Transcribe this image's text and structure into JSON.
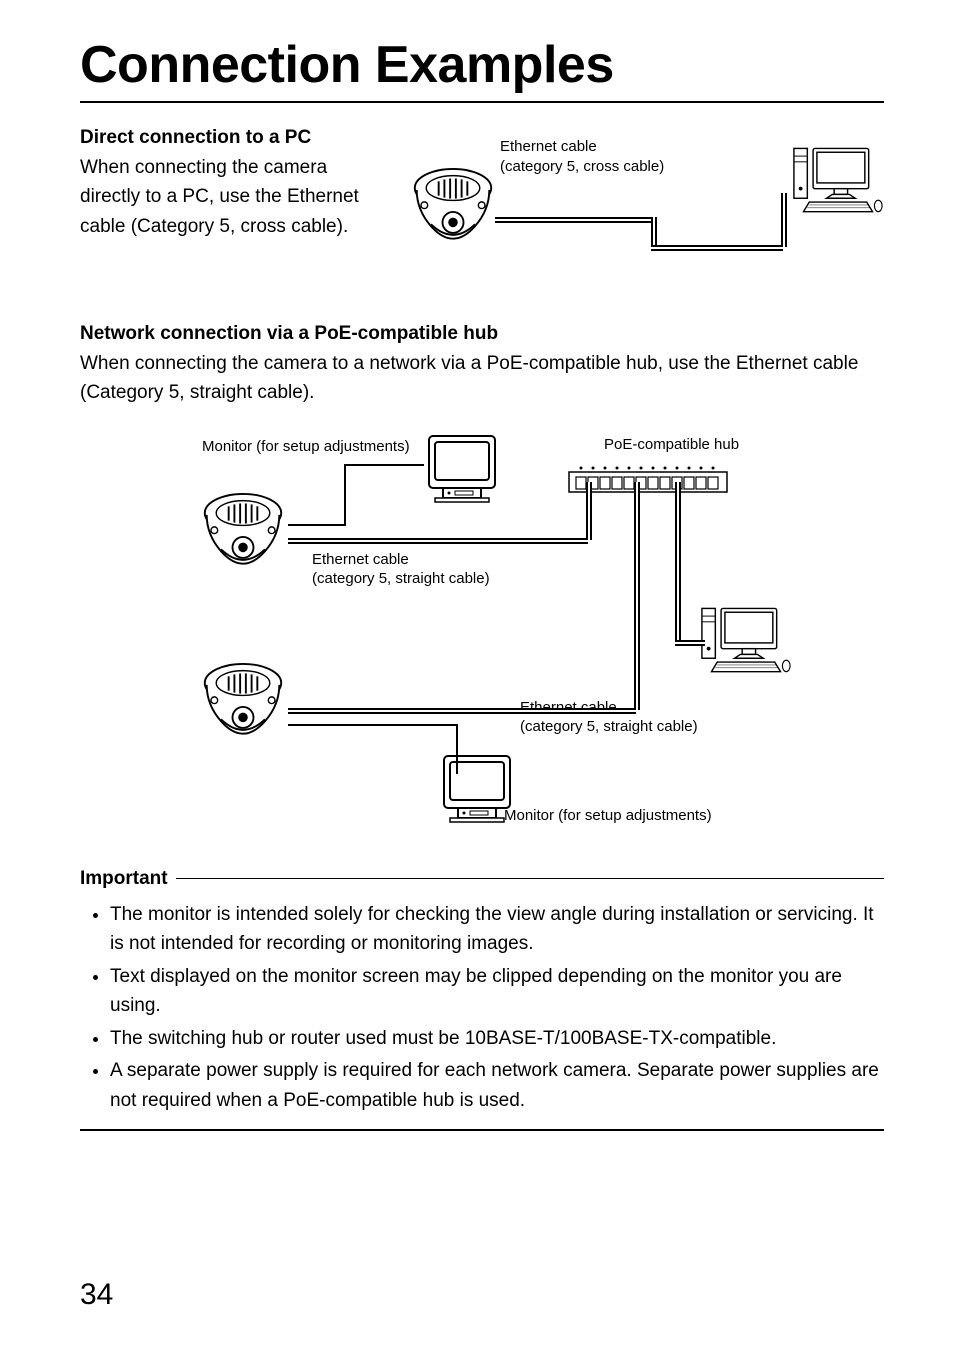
{
  "title": "Connection Examples",
  "section1": {
    "heading": "Direct connection to a PC",
    "text": "When connecting the camera directly to a PC, use the Ethernet cable (Category 5, cross cable).",
    "label_cable_line1": "Ethernet cable",
    "label_cable_line2": "(category 5, cross cable)"
  },
  "section2": {
    "heading": "Network connection via a PoE-compatible hub",
    "text": "When connecting the camera to a network via a PoE-compatible hub, use the Ethernet cable (Category 5, straight cable).",
    "label_monitor1": "Monitor (for setup adjustments)",
    "label_hub": "PoE-compatible hub",
    "label_eth1_line1": "Ethernet cable",
    "label_eth1_line2": "(category 5, straight cable)",
    "label_eth2_line1": "Ethernet cable",
    "label_eth2_line2": "(category 5, straight cable)",
    "label_monitor2": "Monitor (for setup adjustments)"
  },
  "important": {
    "heading": "Important",
    "items": [
      "The monitor is intended solely for checking the view angle during installation or servicing. It is not intended for recording or monitoring images.",
      "Text displayed on the monitor screen may be clipped depending on the monitor you are using.",
      "The switching hub or router used must be 10BASE-T/100BASE-TX-compatible.",
      "A separate power supply is required for each network camera. Separate power supplies are not required when a PoE-compatible hub is used."
    ]
  },
  "page_number": "34"
}
